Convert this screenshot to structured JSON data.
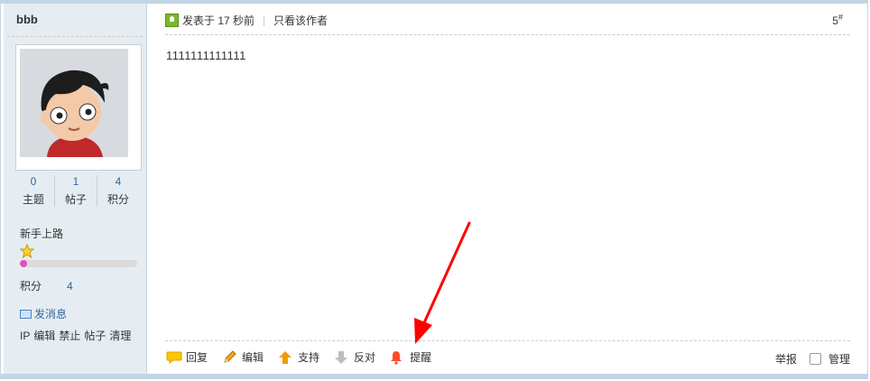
{
  "sidebar": {
    "username": "bbb",
    "stats": [
      {
        "value": "0",
        "label": "主题"
      },
      {
        "value": "1",
        "label": "帖子"
      },
      {
        "value": "4",
        "label": "积分"
      }
    ],
    "rank": "新手上路",
    "progress": 0.06,
    "points_label": "积分",
    "points_value": "4",
    "send_message": "发消息",
    "admin_links": [
      "IP",
      "编辑",
      "禁止",
      "帖子",
      "清理"
    ]
  },
  "post": {
    "posted_label": "发表于 17 秒前",
    "only_author": "只看该作者",
    "floor": "5",
    "floor_mark": "#",
    "content": "1111111111111"
  },
  "actions": {
    "reply": "回复",
    "edit": "编辑",
    "support": "支持",
    "oppose": "反对",
    "remind": "提醒",
    "report": "举报",
    "manage": "管理"
  },
  "colors": {
    "border": "#c2d5e3",
    "sidebar_bg": "#e5edf2",
    "link": "#336699",
    "progress_fill": "#e44fb5",
    "annotation_arrow": "#ff0000"
  }
}
